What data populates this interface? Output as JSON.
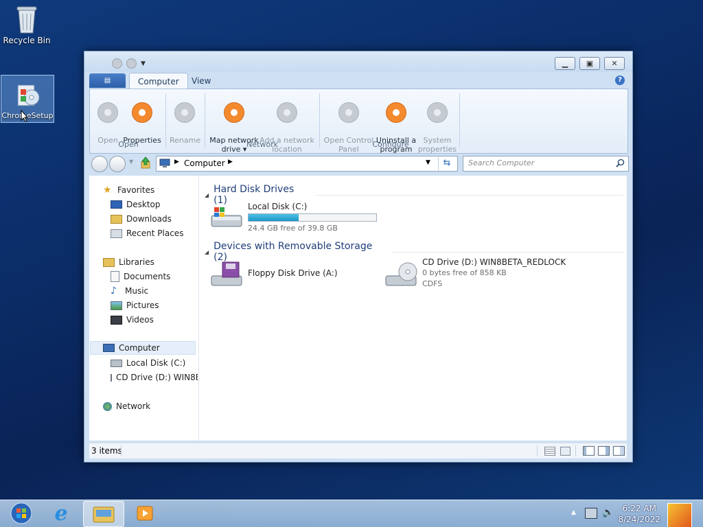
{
  "desktop": {
    "recycle_bin": "Recycle Bin",
    "chrome_setup": "ChromeSetup"
  },
  "window": {
    "tabs": {
      "file": "▤",
      "computer": "Computer",
      "view": "View"
    },
    "help": "?",
    "ribbon": {
      "buttons": [
        {
          "label": "Open",
          "enabled": false
        },
        {
          "label": "Properties",
          "enabled": true
        },
        {
          "label": "Rename",
          "enabled": false
        },
        {
          "label": "Map network\ndrive ▾",
          "enabled": true
        },
        {
          "label": "Add a network\nlocation",
          "enabled": false
        },
        {
          "label": "Open Control\nPanel",
          "enabled": false
        },
        {
          "label": "Uninstall a\nprogram",
          "enabled": true
        },
        {
          "label": "System\nproperties",
          "enabled": false
        }
      ],
      "groups": {
        "open": "Open",
        "network": "Network",
        "configure": "Configure"
      }
    },
    "address": {
      "path": "Computer",
      "search_placeholder": "Search Computer"
    },
    "nav": {
      "favorites": "Favorites",
      "desktop": "Desktop",
      "downloads": "Downloads",
      "recent": "Recent Places",
      "libraries": "Libraries",
      "documents": "Documents",
      "music": "Music",
      "pictures": "Pictures",
      "videos": "Videos",
      "computer": "Computer",
      "local_disk": "Local Disk (C:)",
      "cd_drive": "CD Drive (D:) WIN8B",
      "network": "Network"
    },
    "content": {
      "hdd_header": "Hard Disk Drives (1)",
      "removable_header": "Devices with Removable Storage (2)",
      "local_disk": {
        "name": "Local Disk (C:)",
        "free": "24.4 GB free of 39.8 GB",
        "used_fraction": 0.39
      },
      "floppy": {
        "name": "Floppy Disk Drive (A:)"
      },
      "cd": {
        "name": "CD Drive (D:) WIN8BETA_REDLOCK",
        "free": "0 bytes free of 858 KB",
        "fs": "CDFS"
      }
    },
    "status": {
      "items": "3 items"
    }
  },
  "taskbar": {
    "time": "6:22 AM",
    "date": "8/24/2022"
  },
  "colors": {
    "accent": "#f48a2e",
    "file_tab": "#2b5ea8",
    "desktop": "#0b2d68"
  }
}
